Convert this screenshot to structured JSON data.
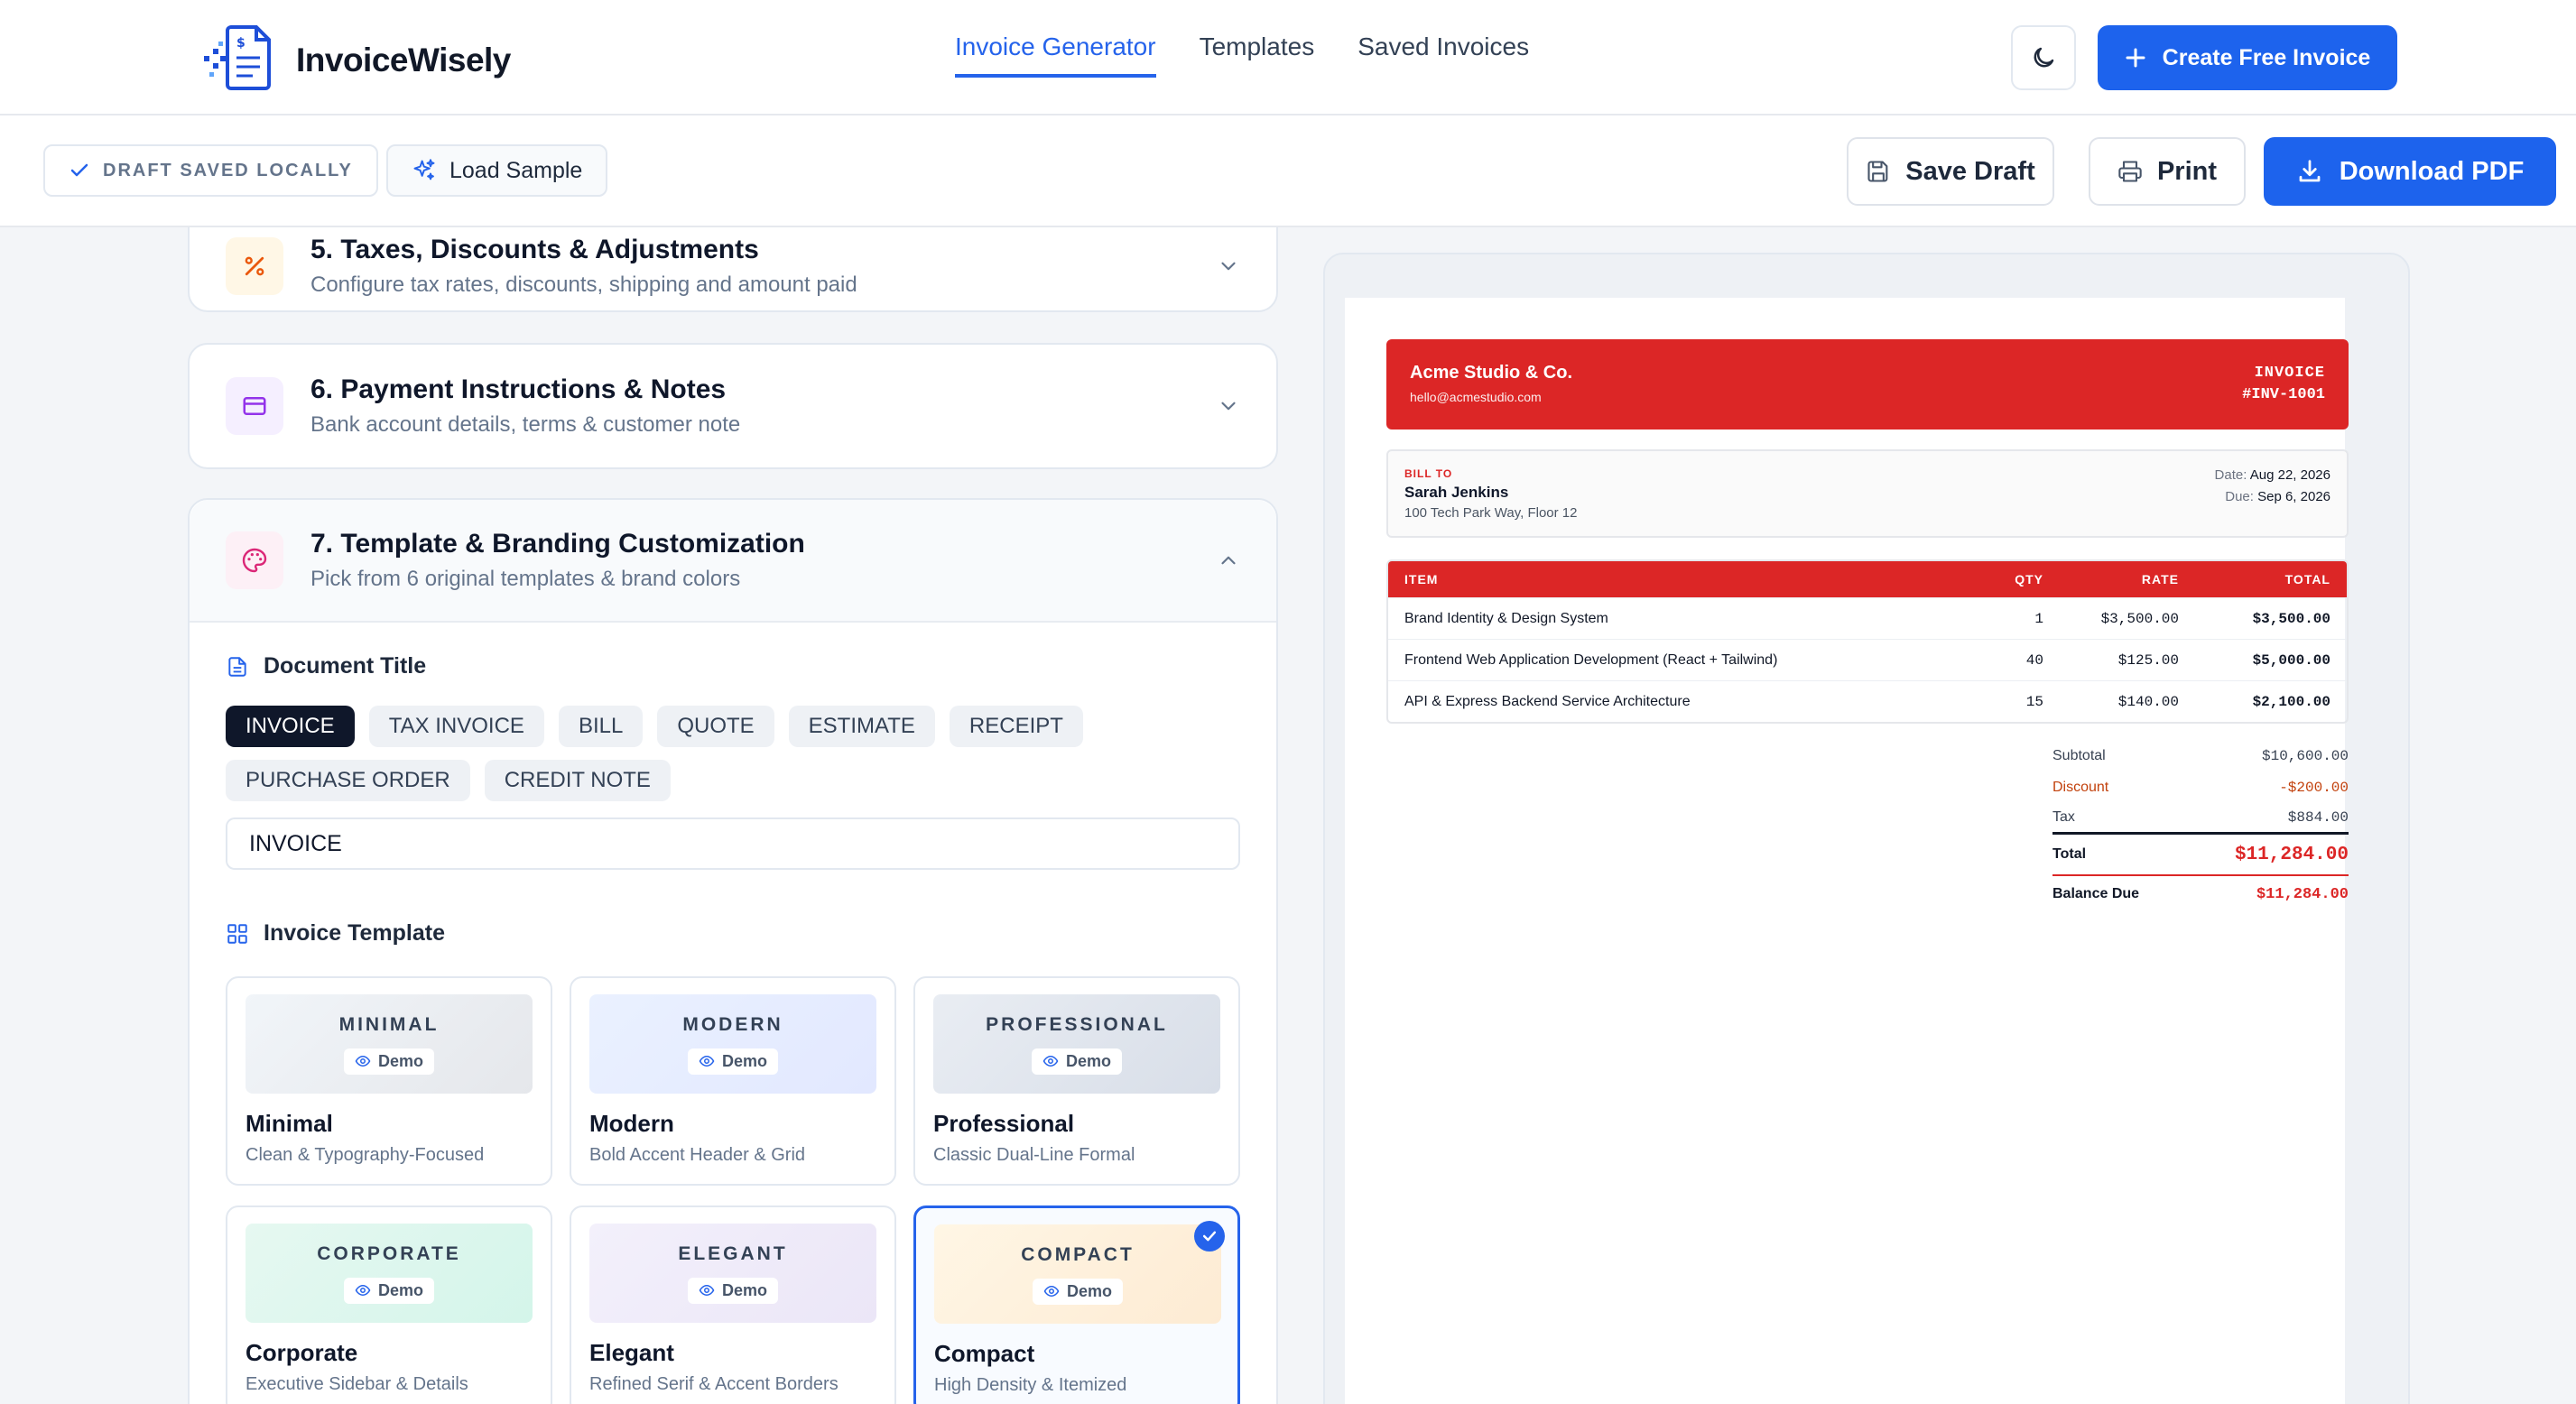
{
  "app": {
    "name": "InvoiceWisely"
  },
  "nav": {
    "links": [
      "Invoice Generator",
      "Templates",
      "Saved Invoices"
    ],
    "active": "Invoice Generator"
  },
  "header": {
    "theme_toggle": "moon-icon",
    "create_label": "Create Free Invoice"
  },
  "toolbar": {
    "draft_status": "DRAFT SAVED LOCALLY",
    "load_sample": "Load Sample",
    "save_draft": "Save Draft",
    "print": "Print",
    "download_pdf": "Download PDF"
  },
  "sections": [
    {
      "title": "5. Taxes, Discounts & Adjustments",
      "subtitle": "Configure tax rates, discounts, shipping and amount paid",
      "icon": "percent-icon",
      "expanded": false
    },
    {
      "title": "6. Payment Instructions & Notes",
      "subtitle": "Bank account details, terms & customer note",
      "icon": "credit-card-icon",
      "expanded": false
    },
    {
      "title": "7. Template & Branding Customization",
      "subtitle": "Pick from 6 original templates & brand colors",
      "icon": "palette-icon",
      "expanded": true
    }
  ],
  "document_title": {
    "label": "Document Title",
    "options": [
      "INVOICE",
      "TAX INVOICE",
      "BILL",
      "QUOTE",
      "ESTIMATE",
      "RECEIPT",
      "PURCHASE ORDER",
      "CREDIT NOTE"
    ],
    "selected": "INVOICE",
    "value": "INVOICE"
  },
  "invoice_template": {
    "label": "Invoice Template",
    "demo_label": "Demo",
    "selected": "Compact",
    "templates": [
      {
        "thumb": "MINIMAL",
        "name": "Minimal",
        "desc": "Clean & Typography-Focused"
      },
      {
        "thumb": "MODERN",
        "name": "Modern",
        "desc": "Bold Accent Header & Grid"
      },
      {
        "thumb": "PROFESSIONAL",
        "name": "Professional",
        "desc": "Classic Dual-Line Formal"
      },
      {
        "thumb": "CORPORATE",
        "name": "Corporate",
        "desc": "Executive Sidebar & Details"
      },
      {
        "thumb": "ELEGANT",
        "name": "Elegant",
        "desc": "Refined Serif & Accent Borders"
      },
      {
        "thumb": "COMPACT",
        "name": "Compact",
        "desc": "High Density & Itemized"
      }
    ]
  },
  "preview": {
    "accent": "#dc2626",
    "company": "Acme Studio & Co.",
    "email": "hello@acmestudio.com",
    "doc_type": "INVOICE",
    "number": "#INV-1001",
    "bill_to_label": "BILL TO",
    "client_name": "Sarah Jenkins",
    "client_address": "100 Tech Park Way, Floor 12",
    "date_label": "Date:",
    "date": "Aug 22, 2026",
    "due_label": "Due:",
    "due": "Sep 6, 2026",
    "columns": [
      "ITEM",
      "QTY",
      "RATE",
      "TOTAL"
    ],
    "items": [
      {
        "item": "Brand Identity & Design System",
        "qty": "1",
        "rate": "$3,500.00",
        "total": "$3,500.00"
      },
      {
        "item": "Frontend Web Application Development (React + Tailwind)",
        "qty": "40",
        "rate": "$125.00",
        "total": "$5,000.00"
      },
      {
        "item": "API & Express Backend Service Architecture",
        "qty": "15",
        "rate": "$140.00",
        "total": "$2,100.00"
      }
    ],
    "subtotal_label": "Subtotal",
    "subtotal": "$10,600.00",
    "discount_label": "Discount",
    "discount": "-$200.00",
    "tax_label": "Tax",
    "tax": "$884.00",
    "total_label": "Total",
    "total": "$11,284.00",
    "balance_label": "Balance Due",
    "balance": "$11,284.00"
  }
}
